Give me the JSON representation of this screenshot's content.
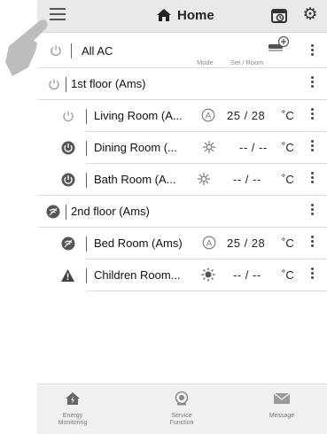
{
  "header": {
    "title": "Home",
    "icons": {
      "menu": "menu-icon",
      "home": "home-icon",
      "timer": "timer-icon",
      "settings": "gear-icon"
    }
  },
  "all_ac": {
    "label": "All AC",
    "mode_label": "Mode",
    "set_room_label": "Set / Room"
  },
  "rows": [
    {
      "label": "1st floor (Ams)",
      "kind": "group"
    },
    {
      "label": "Living Room (A...",
      "mode": "auto",
      "temp": "25 / 28",
      "unit": "˚C"
    },
    {
      "label": "Dining Room (...",
      "mode": "fan",
      "temp": "-- / --",
      "unit": "˚C"
    },
    {
      "label": "Bath Room (A...",
      "mode": "fan",
      "temp": "-- / --",
      "unit": "˚C"
    },
    {
      "label": "2nd floor (Ams)",
      "kind": "group"
    },
    {
      "label": "Bed Room (Ams)",
      "mode": "auto",
      "temp": "25 / 28",
      "unit": "˚C"
    },
    {
      "label": "Children Room...",
      "mode": "sun",
      "temp": "-- / --",
      "unit": "˚C"
    }
  ],
  "bottom_nav": {
    "energy_1": "Energy",
    "energy_2": "Monitoring",
    "service_1": "Service",
    "service_2": "Function",
    "message": "Message"
  },
  "colors": {
    "topbar": "#e9e9e9",
    "bottombar": "#f0f0f0",
    "text": "#222222"
  }
}
